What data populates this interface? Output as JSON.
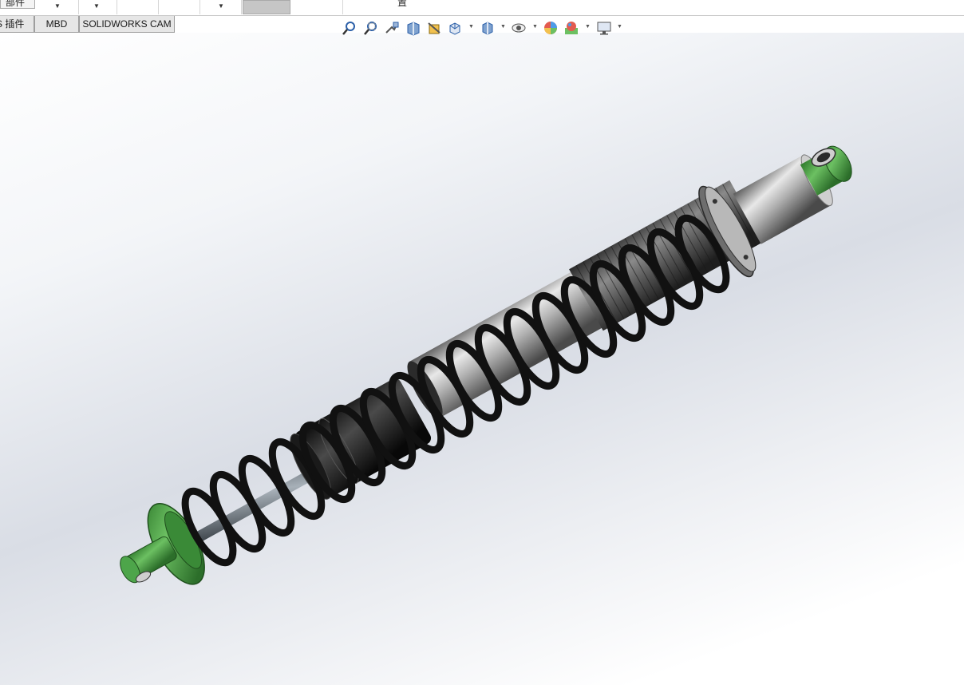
{
  "ribbon": {
    "label": "部件",
    "partial_text": "置"
  },
  "tabs": [
    {
      "label": "S 插件"
    },
    {
      "label": "MBD"
    },
    {
      "label": "SOLIDWORKS CAM"
    }
  ],
  "heads_up_toolbar": [
    "zoom-to-fit-icon",
    "zoom-to-area-icon",
    "previous-view-icon",
    "section-view-icon",
    "dynamic-annotation-views-icon",
    "view-orientation-icon",
    "display-style-icon",
    "hide-show-items-icon",
    "edit-appearance-icon",
    "apply-scene-icon",
    "view-settings-icon"
  ],
  "model": {
    "name": "coilover-shock-absorber",
    "colors": {
      "spring": "#141414",
      "end_fitting": "#3f9a3c",
      "body": "#9c9c9c",
      "bellows": "#3a3a3a",
      "rod": "#6f7880"
    }
  }
}
